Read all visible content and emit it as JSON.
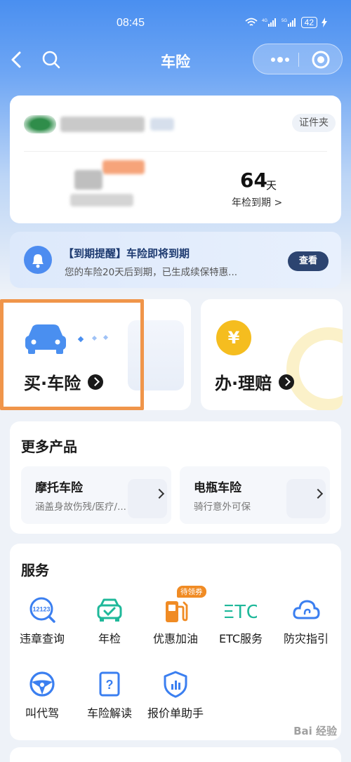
{
  "status_bar": {
    "time": "08:45",
    "network": "4G 5G",
    "battery": "42"
  },
  "nav": {
    "title": "车险"
  },
  "vehicle": {
    "cert_label": "证件夹",
    "days": "64",
    "days_unit": "天",
    "days_label": "年检到期 >"
  },
  "reminder": {
    "title": "【到期提醒】车险即将到期",
    "text": "您的车险20天后到期，已生成续保特惠...",
    "button": "查看"
  },
  "actions": {
    "buy_label": "买·车险",
    "claim_label": "办·理赔",
    "yen": "¥"
  },
  "products": {
    "title": "更多产品",
    "items": [
      {
        "name": "摩托车险",
        "desc": "涵盖身故伤残/医疗/..."
      },
      {
        "name": "电瓶车险",
        "desc": "骑行意外可保"
      }
    ]
  },
  "services": {
    "title": "服务",
    "badge": "待领券",
    "items": [
      {
        "label": "违章查询",
        "icon": "violation-query-icon",
        "icon_text": "12123"
      },
      {
        "label": "年检",
        "icon": "annual-check-icon"
      },
      {
        "label": "优惠加油",
        "icon": "fuel-pump-icon"
      },
      {
        "label": "ETC服务",
        "icon": "etc-icon",
        "icon_text": "ETC"
      },
      {
        "label": "防灾指引",
        "icon": "disaster-cloud-icon"
      },
      {
        "label": "叫代驾",
        "icon": "steering-wheel-icon"
      },
      {
        "label": "车险解读",
        "icon": "policy-doc-icon",
        "icon_text": "?"
      },
      {
        "label": "报价单助手",
        "icon": "quote-shield-icon"
      }
    ]
  },
  "watermark": "Bai 经验",
  "colors": {
    "primary": "#4a8ff0",
    "highlight": "#f0954a",
    "service_teal": "#1fb89a",
    "service_blue": "#3b7ff0",
    "fuel_orange": "#f08b24"
  }
}
